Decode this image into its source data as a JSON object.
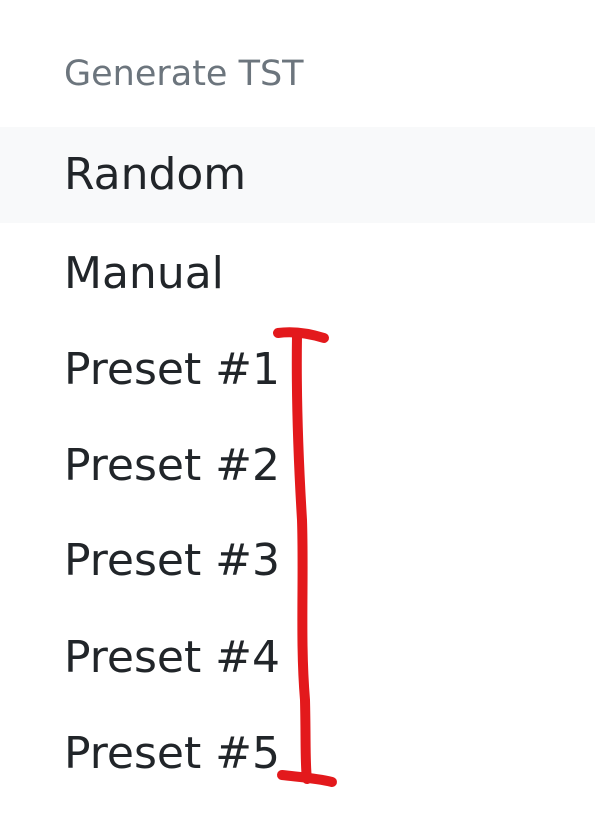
{
  "dropdown": {
    "header": "Generate TST",
    "items": [
      {
        "label": "Random",
        "active": true
      },
      {
        "label": "Manual",
        "active": false
      },
      {
        "label": "Preset #1",
        "active": false
      },
      {
        "label": "Preset #2",
        "active": false
      },
      {
        "label": "Preset #3",
        "active": false
      },
      {
        "label": "Preset #4",
        "active": false
      },
      {
        "label": "Preset #5",
        "active": false
      }
    ]
  },
  "annotation": {
    "shape": "bracket",
    "color": "#e3191c",
    "spans": "Preset #1 to Preset #5"
  }
}
